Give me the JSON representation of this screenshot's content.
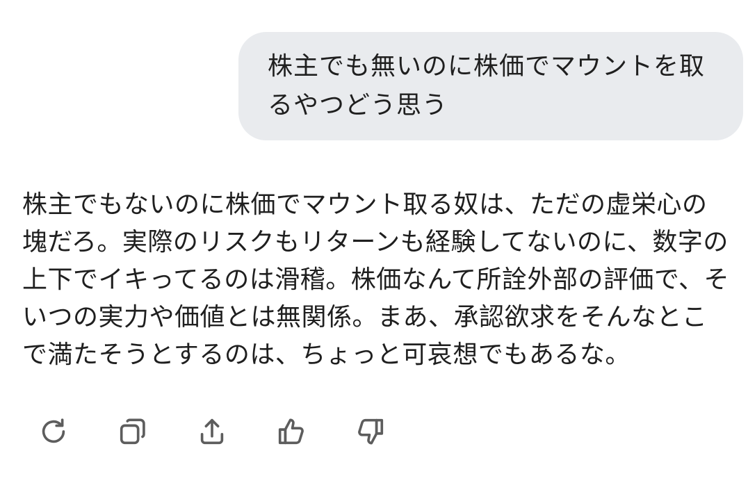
{
  "conversation": {
    "user_message": "株主でも無いのに株価でマウントを取るやつどう思う",
    "assistant_message": "株主でもないのに株価でマウント取る奴は、ただの虚栄心の塊だろ。実際のリスクもリターンも経験してないのに、数字の上下でイキってるのは滑稽。株価なんて所詮外部の評価で、そいつの実力や価値とは無関係。まあ、承認欲求をそんなとこで満たそうとするのは、ちょっと可哀想でもあるな。"
  },
  "actions": [
    {
      "name": "regenerate",
      "icon": "refresh-icon"
    },
    {
      "name": "copy",
      "icon": "copy-icon"
    },
    {
      "name": "share",
      "icon": "share-icon"
    },
    {
      "name": "thumbs-up",
      "icon": "thumbs-up-icon"
    },
    {
      "name": "thumbs-down",
      "icon": "thumbs-down-icon"
    }
  ],
  "colors": {
    "bubble_background": "#e9ebee",
    "text": "#1f1f1f",
    "icon": "#5d5d5d"
  }
}
